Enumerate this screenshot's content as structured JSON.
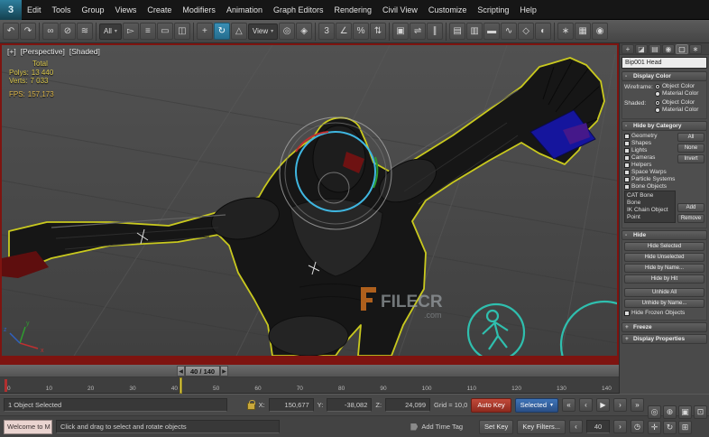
{
  "app": {
    "logo_glyph": "3"
  },
  "menubar": {
    "items": [
      "Edit",
      "Tools",
      "Group",
      "Views",
      "Create",
      "Modifiers",
      "Animation",
      "Graph Editors",
      "Rendering",
      "Civil View",
      "Customize",
      "Scripting",
      "Help"
    ]
  },
  "toolbar": {
    "select_filter_value": "All",
    "coord_system_value": "View",
    "dropdown_arrow": "▾",
    "icons": [
      {
        "name": "undo-icon",
        "glyph": "↶"
      },
      {
        "name": "redo-icon",
        "glyph": "↷"
      },
      {
        "name": "select-and-link-icon",
        "glyph": "∞"
      },
      {
        "name": "unlink-selection-icon",
        "glyph": "⊘"
      },
      {
        "name": "bind-to-space-warp-icon",
        "glyph": "≋"
      },
      {
        "name": "select-object-icon",
        "glyph": "▻"
      },
      {
        "name": "select-by-name-icon",
        "glyph": "≡"
      },
      {
        "name": "rectangular-selection-region-icon",
        "glyph": "▭"
      },
      {
        "name": "window-crossing-icon",
        "glyph": "◫"
      },
      {
        "name": "select-and-move-icon",
        "glyph": "+"
      },
      {
        "name": "select-and-rotate-icon",
        "glyph": "↻"
      },
      {
        "name": "select-and-scale-icon",
        "glyph": "△"
      },
      {
        "name": "use-pivot-center-icon",
        "glyph": "◎"
      },
      {
        "name": "select-and-manipulate-icon",
        "glyph": "◈"
      },
      {
        "name": "snap-toggle-icon",
        "glyph": "3"
      },
      {
        "name": "angle-snap-icon",
        "glyph": "∠"
      },
      {
        "name": "percent-snap-icon",
        "glyph": "%"
      },
      {
        "name": "spinner-snap-icon",
        "glyph": "⇅"
      },
      {
        "name": "named-selection-sets-icon",
        "glyph": "▣"
      },
      {
        "name": "mirror-icon",
        "glyph": "⇌"
      },
      {
        "name": "align-icon",
        "glyph": "∥"
      },
      {
        "name": "scene-explorer-icon",
        "glyph": "▤"
      },
      {
        "name": "layer-explorer-icon",
        "glyph": "▥"
      },
      {
        "name": "ribbon-icon",
        "glyph": "▬"
      },
      {
        "name": "curve-editor-icon",
        "glyph": "∿"
      },
      {
        "name": "schematic-view-icon",
        "glyph": "◇"
      },
      {
        "name": "material-editor-icon",
        "glyph": "◐"
      },
      {
        "name": "render-setup-icon",
        "glyph": "∗"
      },
      {
        "name": "rendered-frame-icon",
        "glyph": "▦"
      },
      {
        "name": "render-production-icon",
        "glyph": "◉"
      }
    ]
  },
  "viewport": {
    "menu_general": "[+]",
    "menu_pov": "[Perspective]",
    "menu_shading": "[Shaded]",
    "stats": {
      "total": "Total",
      "polys_label": "Polys:",
      "polys_value": "13 440",
      "verts_label": "Verts:",
      "verts_value": "7 033",
      "fps_label": "FPS:",
      "fps_value": "157,173"
    },
    "watermark_text": "FILECR",
    "watermark_sub": ".com",
    "axis": {
      "x": "x",
      "y": "y",
      "z": "z"
    }
  },
  "panel": {
    "tabs": [
      {
        "name": "create-tab",
        "glyph": "+"
      },
      {
        "name": "modify-tab",
        "glyph": "◪"
      },
      {
        "name": "hierarchy-tab",
        "glyph": "▤"
      },
      {
        "name": "motion-tab",
        "glyph": "◉"
      },
      {
        "name": "display-tab",
        "glyph": "▢"
      },
      {
        "name": "utilities-tab",
        "glyph": "∗"
      }
    ],
    "object_name": "Bip001 Head",
    "collapse_glyph": "-",
    "expand_glyph": "+",
    "display_color": {
      "title": "Display Color",
      "wireframe_label": "Wireframe:",
      "shaded_label": "Shaded:",
      "object_color": "Object Color",
      "material_color": "Material Color"
    },
    "hide_by_category": {
      "title": "Hide by Category",
      "items": [
        "Geometry",
        "Shapes",
        "Lights",
        "Cameras",
        "Helpers",
        "Space Warps",
        "Particle Systems",
        "Bone Objects"
      ],
      "all": "All",
      "none": "None",
      "invert": "Invert",
      "list": [
        "CAT Bone",
        "Bone",
        "IK Chain Object",
        "Point"
      ],
      "add": "Add",
      "remove": "Remove"
    },
    "hide": {
      "title": "Hide",
      "buttons": [
        "Hide Selected",
        "Hide Unselected",
        "Hide by Name...",
        "Hide by Hit"
      ],
      "buttons2": [
        "Unhide All",
        "Unhide by Name..."
      ],
      "frozen_label": "Hide Frozen Objects"
    },
    "freeze_title": "Freeze",
    "display_properties_title": "Display Properties"
  },
  "timeline": {
    "handle": "40 / 140",
    "left_arrow": "◀",
    "right_arrow": "▶",
    "ticks": [
      "0",
      "10",
      "20",
      "30",
      "40",
      "50",
      "60",
      "70",
      "80",
      "90",
      "100",
      "110",
      "120",
      "130",
      "140"
    ]
  },
  "status": {
    "selection": "1 Object Selected",
    "welcome": "Welcome to M",
    "prompt": "Click and drag to select and rotate objects",
    "x_label": "X:",
    "x_value": "150,677",
    "y_label": "Y:",
    "y_value": "-38,082",
    "z_label": "Z:",
    "z_value": "24,099",
    "grid": "Grid = 10,0",
    "add_time_tag": "Add Time Tag",
    "auto_key": "Auto Key",
    "selected_mode": "Selected",
    "set_key": "Set Key",
    "key_filters": "Key Filters...",
    "frame_value": "40"
  },
  "transport": {
    "icons": [
      {
        "name": "go-to-start-icon",
        "glyph": "«"
      },
      {
        "name": "previous-frame-icon",
        "glyph": "‹"
      },
      {
        "name": "play-icon",
        "glyph": "▶"
      },
      {
        "name": "next-frame-icon",
        "glyph": "›"
      },
      {
        "name": "go-to-end-icon",
        "glyph": "»"
      }
    ],
    "frame_down": "‹",
    "frame_up": "›",
    "time_config_icon": "◷",
    "nav_icons": [
      {
        "name": "zoom-icon",
        "glyph": "◎"
      },
      {
        "name": "zoom-all-icon",
        "glyph": "⊕"
      },
      {
        "name": "zoom-extents-icon",
        "glyph": "▣"
      },
      {
        "name": "zoom-region-icon",
        "glyph": "⊡"
      },
      {
        "name": "pan-icon",
        "glyph": "✛"
      },
      {
        "name": "orbit-icon",
        "glyph": "↻"
      },
      {
        "name": "maximize-viewport-icon",
        "glyph": "⊞"
      }
    ]
  }
}
